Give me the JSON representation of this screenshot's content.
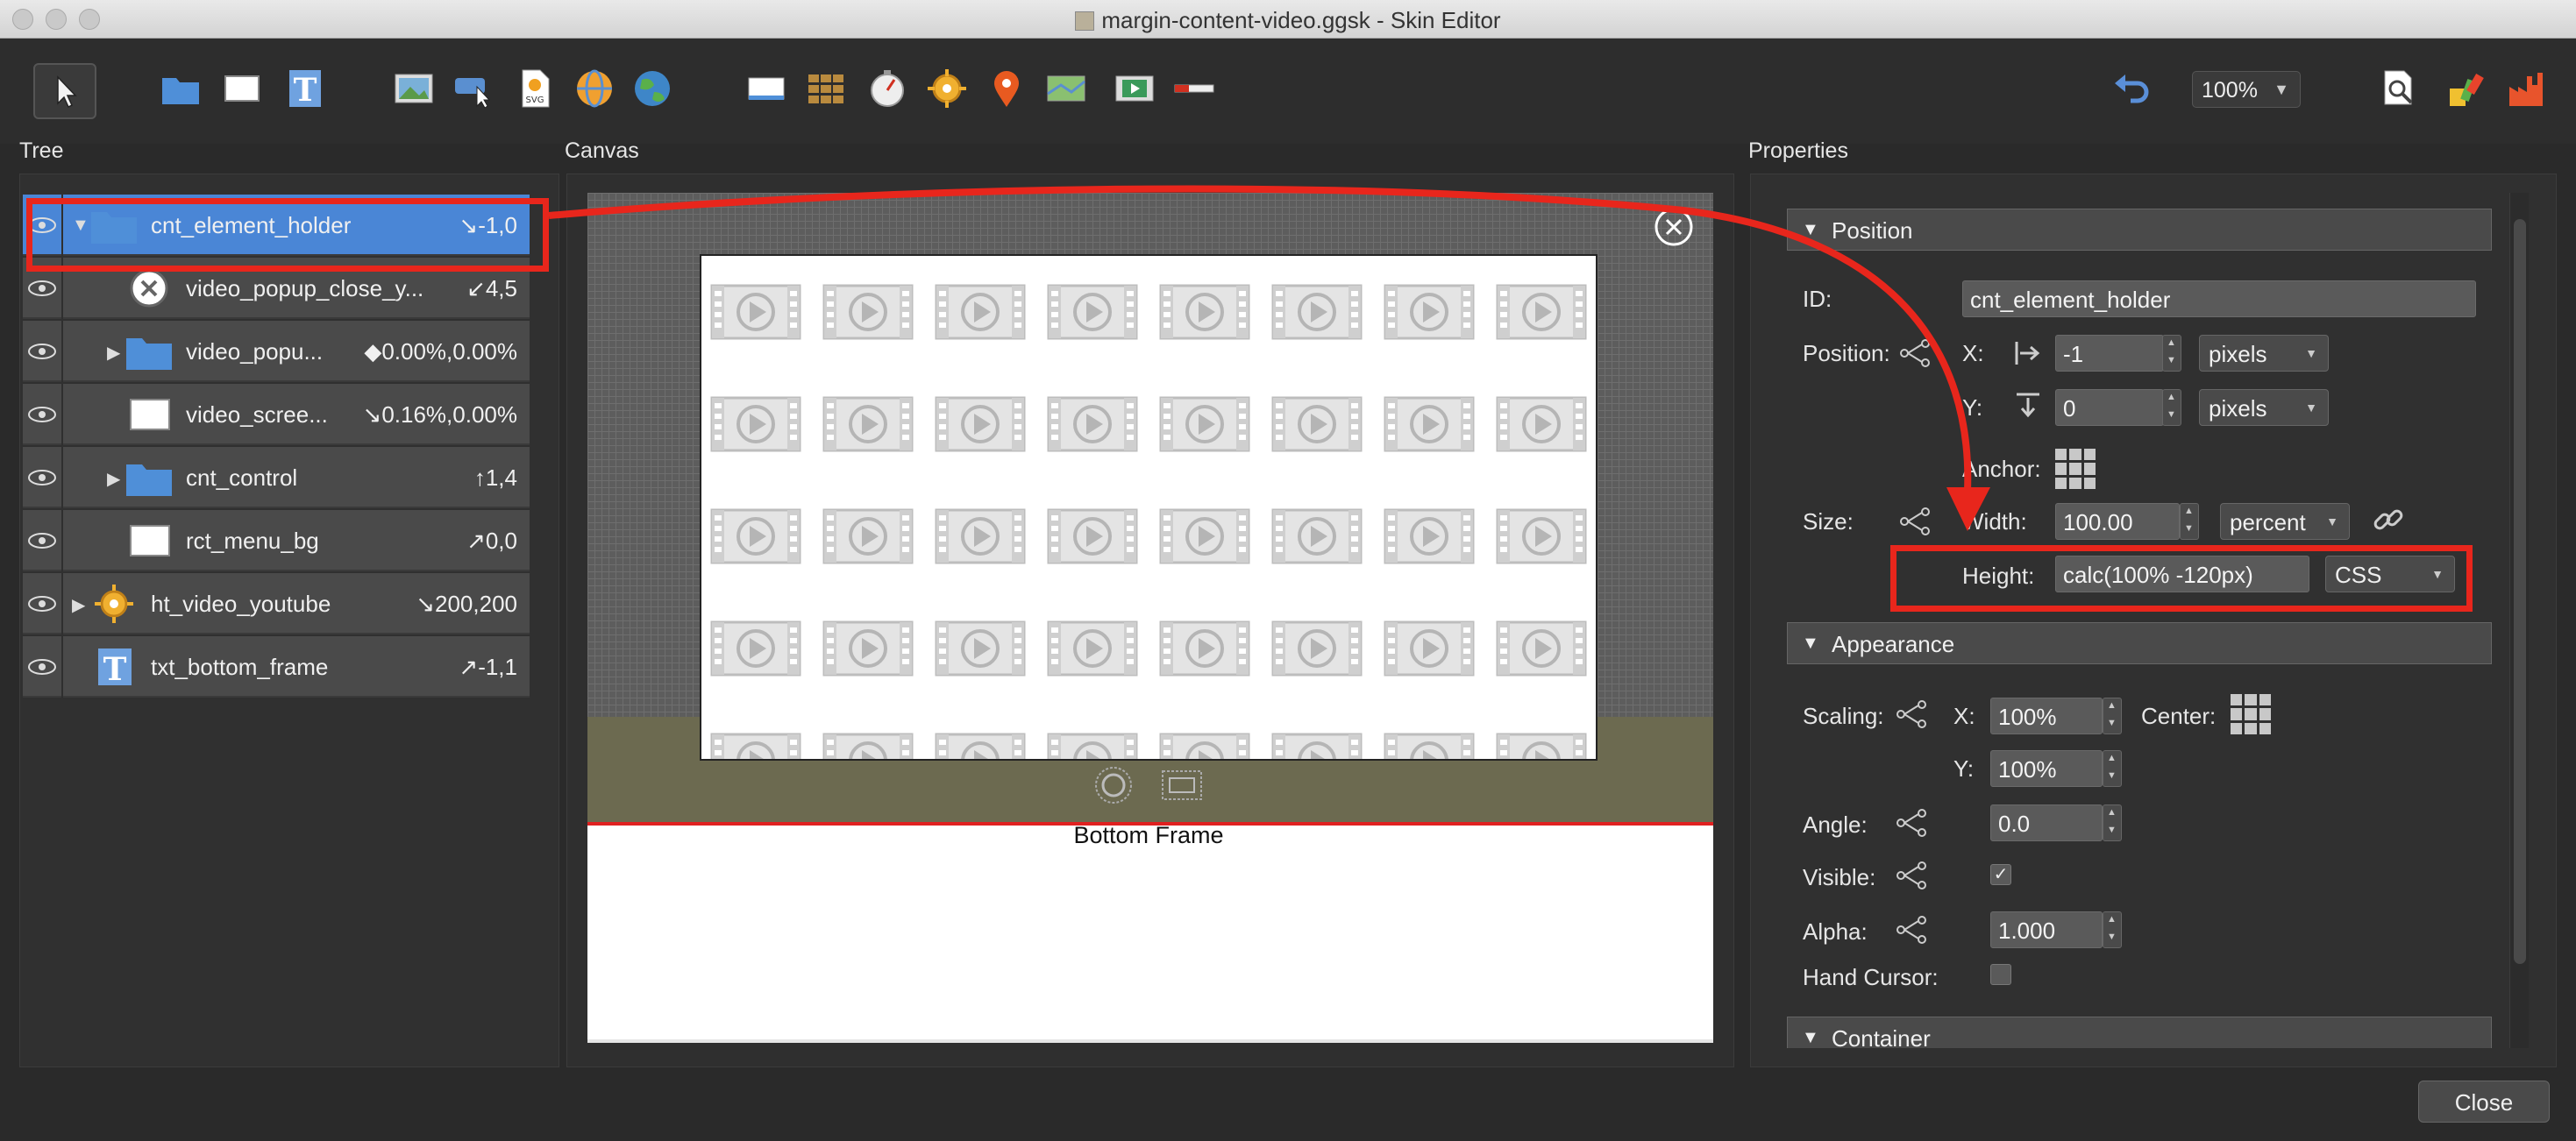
{
  "window": {
    "title": "margin-content-video.ggsk - Skin Editor"
  },
  "toolbar": {
    "zoom_value": "100%"
  },
  "panels": {
    "tree_label": "Tree",
    "canvas_label": "Canvas",
    "properties_label": "Properties"
  },
  "tree": {
    "rows": [
      {
        "name": "cnt_element_holder",
        "value": "↘-1,0",
        "icon": "folder-icon",
        "expander": "▼"
      },
      {
        "name": "video_popup_close_y...",
        "value": "↙4,5",
        "icon": "close-circle-icon",
        "expander": ""
      },
      {
        "name": "video_popu...",
        "value": "◆0.00%,0.00%",
        "icon": "folder-icon",
        "expander": "▶"
      },
      {
        "name": "video_scree...",
        "value": "↘0.16%,0.00%",
        "icon": "rectangle-icon",
        "expander": ""
      },
      {
        "name": "cnt_control",
        "value": "↑1,4",
        "icon": "folder-icon",
        "expander": "▶"
      },
      {
        "name": "rct_menu_bg",
        "value": "↗0,0",
        "icon": "rectangle-icon",
        "expander": ""
      },
      {
        "name": "ht_video_youtube",
        "value": "↘200,200",
        "icon": "hotspot-icon",
        "expander": "▶"
      },
      {
        "name": "txt_bottom_frame",
        "value": "↗-1,1",
        "icon": "text-icon",
        "expander": ""
      }
    ]
  },
  "canvas": {
    "bottom_frame_text": "Bottom Frame"
  },
  "properties": {
    "position_section": "Position",
    "id_label": "ID:",
    "id_value": "cnt_element_holder",
    "position_label": "Position:",
    "x_label": "X:",
    "x_value": "-1",
    "x_unit": "pixels",
    "y_label": "Y:",
    "y_value": "0",
    "y_unit": "pixels",
    "anchor_label": "Anchor:",
    "size_label": "Size:",
    "width_label": "Width:",
    "width_value": "100.00",
    "width_unit": "percent",
    "height_label": "Height:",
    "height_value": "calc(100% -120px)",
    "height_unit": "CSS",
    "appearance_section": "Appearance",
    "scaling_label": "Scaling:",
    "scale_x_label": "X:",
    "scale_x_value": "100%",
    "center_label": "Center:",
    "scale_y_label": "Y:",
    "scale_y_value": "100%",
    "angle_label": "Angle:",
    "angle_value": "0.0",
    "visible_label": "Visible:",
    "visible_checked": "✓",
    "alpha_label": "Alpha:",
    "alpha_value": "1.000",
    "hand_cursor_label": "Hand Cursor:",
    "container_section": "Container"
  },
  "footer": {
    "close_label": "Close"
  },
  "colors": {
    "selection": "#4a86d6",
    "annotation_red": "#e8261c",
    "olive_band": "#6c6a50"
  }
}
